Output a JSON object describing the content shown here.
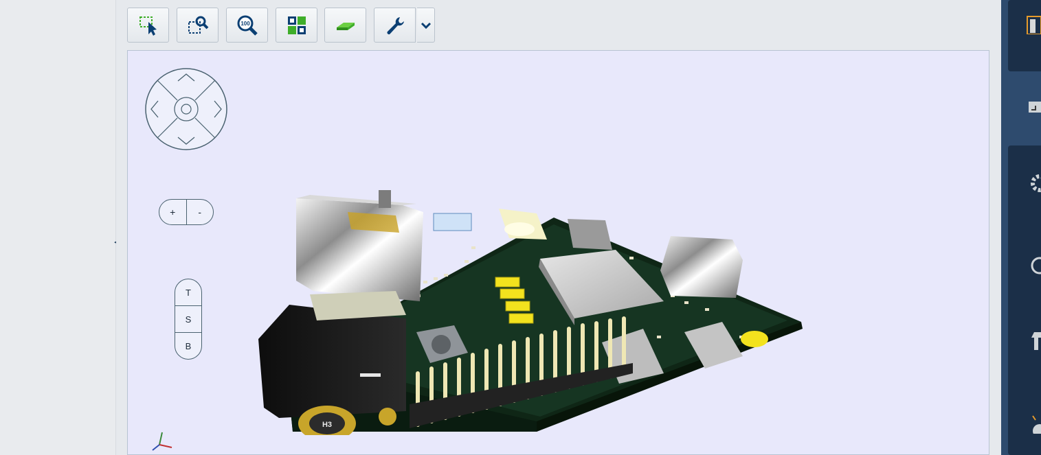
{
  "toolbar": {
    "buttons": [
      {
        "name": "select-area-icon"
      },
      {
        "name": "zoom-area-icon"
      },
      {
        "name": "zoom-100-icon",
        "label": "100"
      },
      {
        "name": "view-tiles-icon"
      },
      {
        "name": "layer-board-icon"
      },
      {
        "name": "wrench-icon"
      }
    ],
    "dropdown_icon": "chevron-down-icon"
  },
  "viewer": {
    "zoom_in": "+",
    "zoom_out": "-",
    "views": [
      "T",
      "S",
      "B"
    ],
    "board_hole_label": "H3"
  },
  "colors": {
    "toolbar_icon": "#0b3f73",
    "accent_green": "#3fae2a",
    "viewport_bg": "#e8e8fb",
    "right_panel": "#2e4b6e"
  }
}
